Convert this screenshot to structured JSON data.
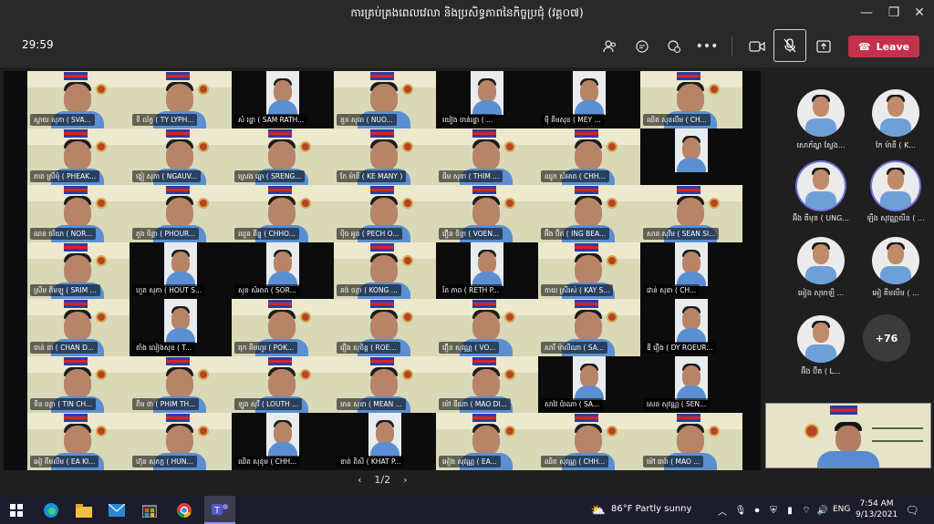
{
  "window": {
    "title": "ការគ្រប់គ្រងពេលវេលា និងប្រសិទ្ធភាពនៃកិច្ចប្រជុំ (វគ្គ០៧)"
  },
  "toolbar": {
    "timer": "29:59",
    "leave_label": "Leave"
  },
  "grid_names": [
    "ស្តាយ សុភា ( SVA...",
    "ទី ល័ក្ខ ( TY LYPH...",
    "សំ រដ្ឋា ( SAM RATH...",
    "នួន សុធា ( NUO...",
    "យៀង ចាន់រដ្ឋា ( ...",
    "ម៉ី គីមសុខ ( MEY ...",
    "ឈិត សុខលីម ( CH...",
    "ភាព ស្រីមុំ ( PHEAK...",
    "ង្វៀ សុភា ( NGAUV...",
    "ស្រេង ឆ្នោ ( SRENG...",
    "កែ ម៉ានី ( KE MANY )",
    "ធីម សុខា ( THIM ...",
    "ឈូក សំអាត ( CHH...",
    "",
    "ណន ចរិយា ( NOR...",
    "ភួង ចិន្តា ( PHOUR...",
    "ឈួន ពិន្ទុ ( CHHO...",
    "ប៉ិច អូន ( PECH O...",
    "វឿន ចិន្តា ( VOEN...",
    "អ៊ឹង ប៊ីត ( ING BEA...",
    "សាន សុវីម ( SEAN SI...",
    "ស្រីម គីមឡូ ( SRIM ...",
    "ហួត សុភា ( HOUT S...",
    "សុខ សំអាត ( SOR...",
    "គង់ ចន្ថា ( KONG ...",
    "រ័ត ភាព ( RETH P...",
    "កាយ ស្រីរស់ ( KAY S...",
    "ជាន់ សុខា ( CH...",
    "ចាន់ ដា ( CHAN D...",
    "តាំង លៀងសុខ ( T...",
    "ពុក គីមហួរ ( POK...",
    "រឿង សុចិន្ត ( ROE...",
    "វឿន សុវណ្ណ ( VO...",
    "សារី ម៉ាលីណា ( SA...",
    "ឌី រឿង ( DY ROEUR...",
    "ទីន ចន្ថា ( TIN CH...",
    "ភឹម ថា ( PHIM TH...",
    "ឡូត សុវី ( LOUTH ...",
    "មាន សុខា ( MEAN ...",
    "ម៉ៅ ឌីណា ( MAO DI...",
    "សាវៃ ប៉ាណា ( SA...",
    "សេន សុវណ្ណ ( SEN...",
    "អៀ គីមលីម ( EA KI...",
    "ហ៊ុន សុភក្ត ( HUN...",
    "ឈិត សុខុម ( CHH...",
    "ខាត់ ពិសី ( KHAT P...",
    "អៀង សុវណ្ណ ( EA...",
    "ឈិត សុវណ្ណ ( CHH...",
    "ម៉ៅ ធារ៉ា ( MAO ..."
  ],
  "pager": {
    "label": "1/2"
  },
  "gallery": [
    {
      "name": "សោភ័ណ្ឌ ស្វែង..."
    },
    {
      "name": "កែ ម៉ានី ( K..."
    },
    {
      "name": "អ៊ឹង គីមុន ( UNG..."
    },
    {
      "name": "ឡឹង សុវណ្ណលីន ( ..."
    },
    {
      "name": "អៀង សុមាឡី ..."
    },
    {
      "name": "អៀ គីមលីម ( ..."
    },
    {
      "name": "អ៊ឹង ប៊ីត ( L..."
    }
  ],
  "more_participants": "+76",
  "taskbar": {
    "weather": "86°F  Partly sunny",
    "lang": "ENG",
    "time": "7:54 AM",
    "date": "9/13/2021"
  },
  "colors": {
    "accent": "#6264a7",
    "leave": "#c4314b"
  }
}
